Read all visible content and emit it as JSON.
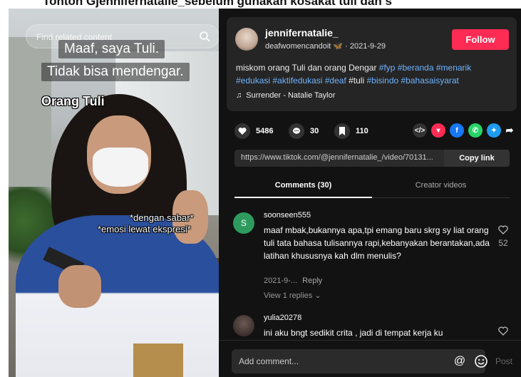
{
  "top_strip_text": "Tonton Gjennifernatalie_sebelum  gunakan  kosakat  tuli  dan  s",
  "video": {
    "search_placeholder": "Find related content",
    "caption_line1": "Maaf, saya Tuli.",
    "caption_line2": "Tidak bisa mendengar.",
    "caption_orang_tuli": "Orang Tuli",
    "caption_sabar": "*dengan sabar*",
    "caption_emosi": "*emosi lewat ekspresi*"
  },
  "post": {
    "username": "jennifernatalie_",
    "subtitle": "deafwomencandoit 🦋 · 2021-9-29",
    "follow_label": "Follow",
    "description_plain1": "miskom orang Tuli dan orang Dengar ",
    "tags1": "#fyp #beranda #menarik",
    "tags2": "#edukasi #aktifedukasi #deaf",
    "plain2": " #tuli ",
    "tags3": "#bisindo #bahasaisyarat",
    "music": "Surrender - Natalie Taylor"
  },
  "actions": {
    "likes": "5486",
    "comments": "30",
    "saves": "110"
  },
  "share": {
    "link": "https://www.tiktok.com/@jennifernatalie_/video/70131...",
    "copy_label": "Copy link"
  },
  "tabs": {
    "comments": "Comments (30)",
    "creator": "Creator videos"
  },
  "comments": [
    {
      "avatar_letter": "S",
      "user": "soonseen555",
      "text": "maaf mbak,bukannya apa,tpi emang baru skrg sy liat orang tuli tata bahasa tulisannya rapi,kebanyakan berantakan,ada latihan khususnya kah dlm menulis?",
      "date": "2021-9-...",
      "reply_label": "Reply",
      "view_replies": "View 1 replies ⌄",
      "likes": "52"
    },
    {
      "user": "yulia20278",
      "text": "ini aku bngt sedikit crita , jadi di tempat kerja ku"
    }
  ],
  "composer": {
    "placeholder": "Add comment...",
    "post_label": "Post"
  },
  "colors": {
    "follow": "#fe2c55",
    "hashtag": "#6fb3ff",
    "panel_bg": "#121212",
    "card_bg": "#252525"
  }
}
